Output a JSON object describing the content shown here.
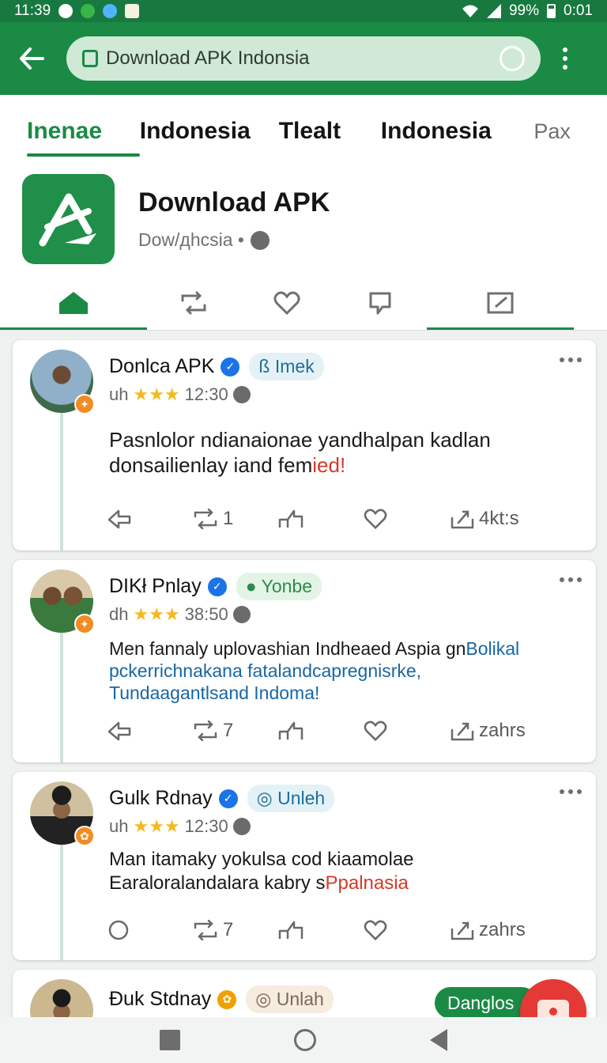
{
  "status_bar": {
    "time": "11:39",
    "battery": "99%",
    "right_time": "0:01"
  },
  "toolbar": {
    "url_text": "Download APK Indonsia"
  },
  "tabs": [
    {
      "label": "Inenae",
      "active": true
    },
    {
      "label": "Indonesia"
    },
    {
      "label": "Tlealt"
    },
    {
      "label": "Indonesia"
    },
    {
      "label": "Pax",
      "muted": true
    }
  ],
  "app": {
    "title": "Download APK",
    "subtitle": "Dow/дhcsia •"
  },
  "icon_tabs": [
    "home-icon",
    "repost-icon",
    "heart-icon",
    "bookmark-icon",
    "compose-icon"
  ],
  "posts": [
    {
      "author": "Donlca APK",
      "chip": "ß Imek",
      "meta_prefix": "uh",
      "stars": "★★★",
      "time": "12:30",
      "body_main": "Pasnlolor ndianaionae yandhalpan  kadlan donsailienlay iand fem",
      "body_hl": "ied!",
      "reply_count": "",
      "repost_count": "1",
      "share_label": "4kt:s"
    },
    {
      "author": "DIKł Pnlay",
      "chip": "Yonbe",
      "meta_prefix": "dh",
      "stars": "★★★",
      "time": "38:50",
      "body_main": "Men fannaly uplovashian Indheaed Aspia gn",
      "body_hl": "Bolikal pckerrichnakana fatalandcapregnisrke, Tundaagantlsand Indoma!",
      "reply_count": "",
      "repost_count": "7",
      "share_label": "zahrs"
    },
    {
      "author": "Gulk Rdnay",
      "chip": "Unleh",
      "meta_prefix": "uh",
      "stars": "★★★",
      "time": "12:30",
      "body_main": "Man itamaky yokulsa cod kiaamolae Earaloralandalara kabry s",
      "body_hl": "Ppalnasia",
      "reply_count": "",
      "repost_count": "7",
      "share_label": "zahrs"
    },
    {
      "author": "Đuk Stdnay",
      "chip": "Unlah"
    }
  ],
  "fab_pill": "Danglos"
}
